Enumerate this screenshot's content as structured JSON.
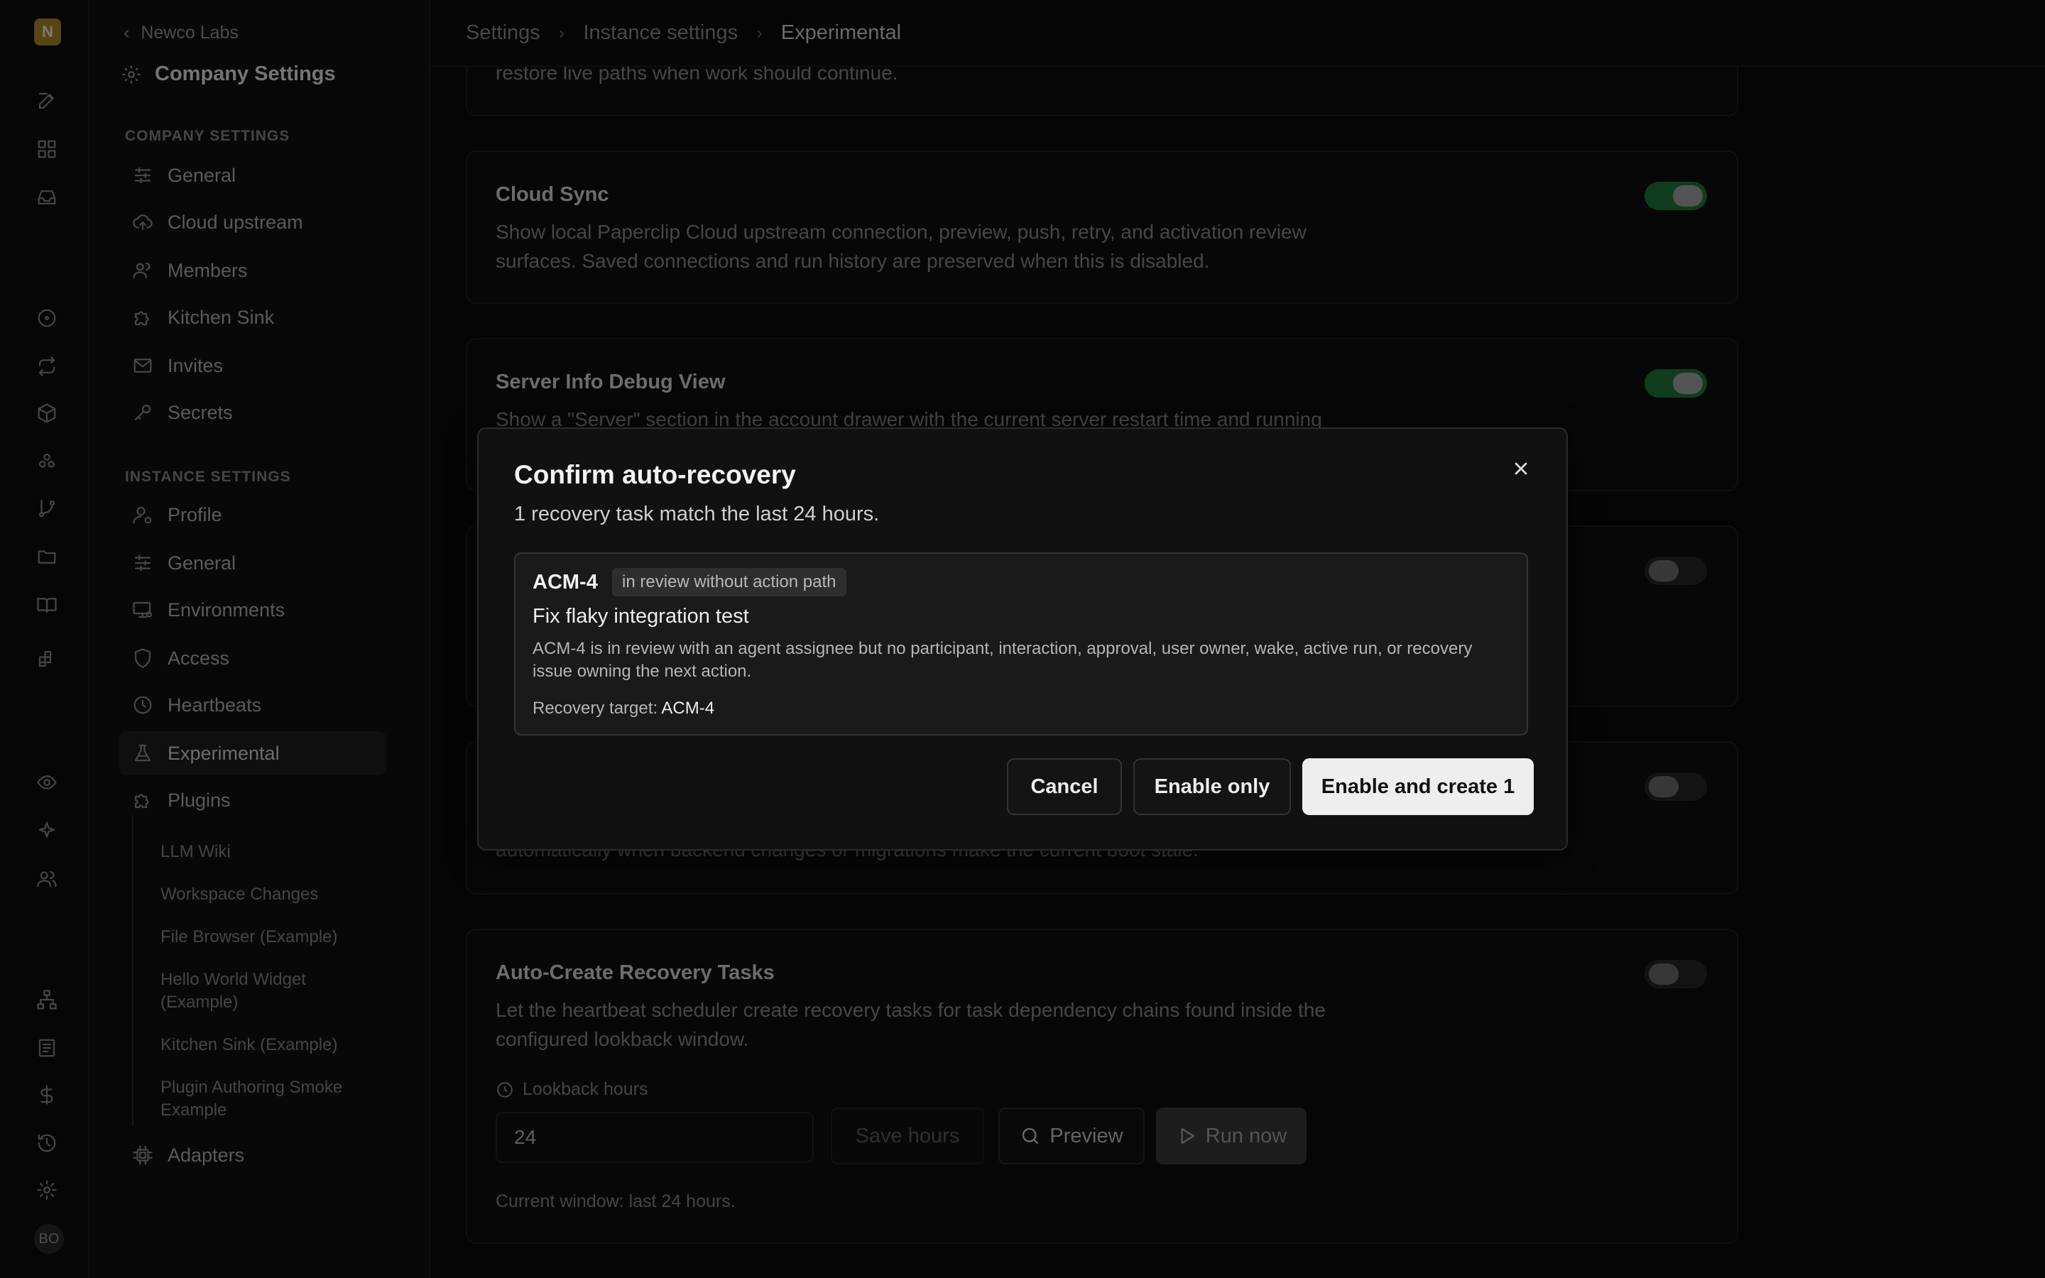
{
  "rail": {
    "logo_letter": "N",
    "avatar_initials": "BO",
    "icons": [
      "edit-icon",
      "dashboard-icon",
      "inbox-icon",
      "circle-dot-icon",
      "repeat-icon",
      "box-icon",
      "network-icon",
      "git-branch-icon",
      "folder-icon",
      "book-icon",
      "grid-icon",
      "eye-icon",
      "sparkle-icon",
      "users-icon",
      "org-chart-icon",
      "document-icon",
      "dollar-icon",
      "history-icon",
      "settings-icon"
    ]
  },
  "sidebar": {
    "back_label": "Newco Labs",
    "title": "Company Settings",
    "company_section": "COMPANY SETTINGS",
    "company_items": [
      {
        "label": "General",
        "icon": "sliders-icon"
      },
      {
        "label": "Cloud upstream",
        "icon": "cloud-upload-icon"
      },
      {
        "label": "Members",
        "icon": "users-icon"
      },
      {
        "label": "Kitchen Sink",
        "icon": "puzzle-icon"
      },
      {
        "label": "Invites",
        "icon": "mail-icon"
      },
      {
        "label": "Secrets",
        "icon": "key-icon"
      }
    ],
    "instance_section": "INSTANCE SETTINGS",
    "instance_items": [
      {
        "label": "Profile",
        "icon": "user-cog-icon"
      },
      {
        "label": "General",
        "icon": "sliders-icon"
      },
      {
        "label": "Environments",
        "icon": "monitor-cog-icon"
      },
      {
        "label": "Access",
        "icon": "shield-icon"
      },
      {
        "label": "Heartbeats",
        "icon": "clock-icon"
      },
      {
        "label": "Experimental",
        "icon": "flask-icon"
      },
      {
        "label": "Plugins",
        "icon": "puzzle-icon"
      }
    ],
    "plugin_items": [
      "LLM Wiki",
      "Workspace Changes",
      "File Browser (Example)",
      "Hello World Widget (Example)",
      "Kitchen Sink (Example)",
      "Plugin Authoring Smoke Example"
    ],
    "adapters_label": "Adapters"
  },
  "breadcrumb": [
    "Settings",
    "Instance settings",
    "Experimental"
  ],
  "cards": {
    "top_partial_desc": "restore live paths when work should continue.",
    "cloud_sync": {
      "title": "Cloud Sync",
      "desc": "Show local Paperclip Cloud upstream connection, preview, push, retry, and activation review surfaces. Saved connections and run history are preserved when this is disabled.",
      "enabled": true
    },
    "server_info": {
      "title": "Server Info Debug View",
      "desc": "Show a \"Server\" section in the account drawer with the current server restart time and running",
      "enabled": true
    },
    "hidden_card_1": {
      "enabled": false
    },
    "hidden_card_2": {
      "desc_partial": "automatically when backend changes or migrations make the current boot stale.",
      "enabled": false
    },
    "auto_recovery": {
      "title": "Auto-Create Recovery Tasks",
      "desc": "Let the heartbeat scheduler create recovery tasks for task dependency chains found inside the configured lookback window.",
      "enabled": false,
      "lookback_label": "Lookback hours",
      "lookback_value": "24",
      "save_label": "Save hours",
      "preview_label": "Preview",
      "run_label": "Run now",
      "current_window": "Current window: last 24 hours."
    }
  },
  "modal": {
    "title": "Confirm auto-recovery",
    "subtitle": "1 recovery task match the last 24 hours.",
    "task": {
      "id": "ACM-4",
      "badge": "in review without action path",
      "title": "Fix flaky integration test",
      "desc": "ACM-4 is in review with an agent assignee but no participant, interaction, approval, user owner, wake, active run, or recovery issue owning the next action.",
      "target_label": "Recovery target:",
      "target_value": "ACM-4"
    },
    "cancel_label": "Cancel",
    "enable_only_label": "Enable only",
    "enable_create_label": "Enable and create 1"
  }
}
